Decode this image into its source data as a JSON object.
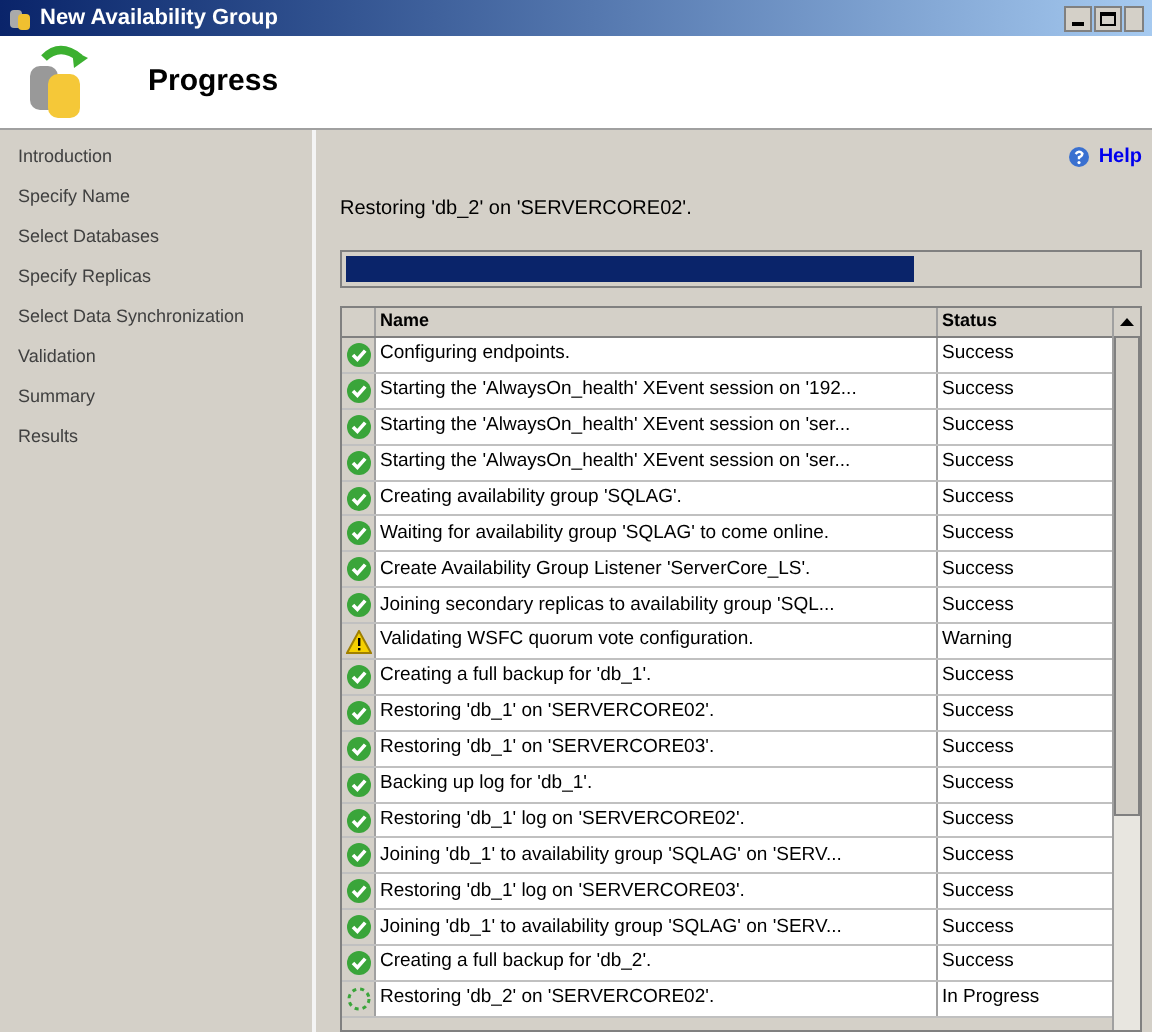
{
  "window": {
    "title": "New Availability Group"
  },
  "header": {
    "title": "Progress"
  },
  "sidebar": {
    "items": [
      {
        "label": "Introduction",
        "selected": false
      },
      {
        "label": "Specify Name",
        "selected": false
      },
      {
        "label": "Select Databases",
        "selected": false
      },
      {
        "label": "Specify Replicas",
        "selected": false
      },
      {
        "label": "Select Data Synchronization",
        "selected": false
      },
      {
        "label": "Validation",
        "selected": false
      },
      {
        "label": "Summary",
        "selected": false
      },
      {
        "label": "Results",
        "selected": false
      }
    ]
  },
  "help": "Help",
  "status_text": "Restoring 'db_2' on 'SERVERCORE02'.",
  "progress": {
    "level": 0.72
  },
  "table": {
    "columns": [
      "Name",
      "Status"
    ],
    "rows": [
      {
        "kind": "success",
        "name": "Configuring endpoints.",
        "status": "Success"
      },
      {
        "kind": "success",
        "name": "Starting the 'AlwaysOn_health' XEvent session on '192...",
        "status": "Success"
      },
      {
        "kind": "success",
        "name": "Starting the 'AlwaysOn_health' XEvent session on 'ser...",
        "status": "Success"
      },
      {
        "kind": "success",
        "name": "Starting the 'AlwaysOn_health' XEvent session on 'ser...",
        "status": "Success"
      },
      {
        "kind": "success",
        "name": "Creating availability group 'SQLAG'.",
        "status": "Success"
      },
      {
        "kind": "success",
        "name": "Waiting for availability group 'SQLAG' to come online.",
        "status": "Success"
      },
      {
        "kind": "success",
        "name": "Create Availability Group Listener 'ServerCore_LS'.",
        "status": "Success"
      },
      {
        "kind": "success",
        "name": "Joining secondary replicas to availability group 'SQL...",
        "status": "Success"
      },
      {
        "kind": "warning",
        "name": "Validating WSFC quorum vote configuration.",
        "status": "Warning"
      },
      {
        "kind": "success",
        "name": "Creating a full backup for 'db_1'.",
        "status": "Success"
      },
      {
        "kind": "success",
        "name": "Restoring 'db_1' on 'SERVERCORE02'.",
        "status": "Success"
      },
      {
        "kind": "success",
        "name": "Restoring 'db_1' on 'SERVERCORE03'.",
        "status": "Success"
      },
      {
        "kind": "success",
        "name": "Backing up log for 'db_1'.",
        "status": "Success"
      },
      {
        "kind": "success",
        "name": "Restoring 'db_1' log on 'SERVERCORE02'.",
        "status": "Success"
      },
      {
        "kind": "success",
        "name": "Joining 'db_1' to availability group 'SQLAG' on 'SERV...",
        "status": "Success"
      },
      {
        "kind": "success",
        "name": "Restoring 'db_1' log on 'SERVERCORE03'.",
        "status": "Success"
      },
      {
        "kind": "success",
        "name": "Joining 'db_1' to availability group 'SQLAG' on 'SERV...",
        "status": "Success"
      },
      {
        "kind": "success",
        "name": "Creating a full backup for 'db_2'.",
        "status": "Success"
      },
      {
        "kind": "progress",
        "name": "Restoring 'db_2' on 'SERVERCORE02'.",
        "status": "In Progress"
      }
    ]
  }
}
